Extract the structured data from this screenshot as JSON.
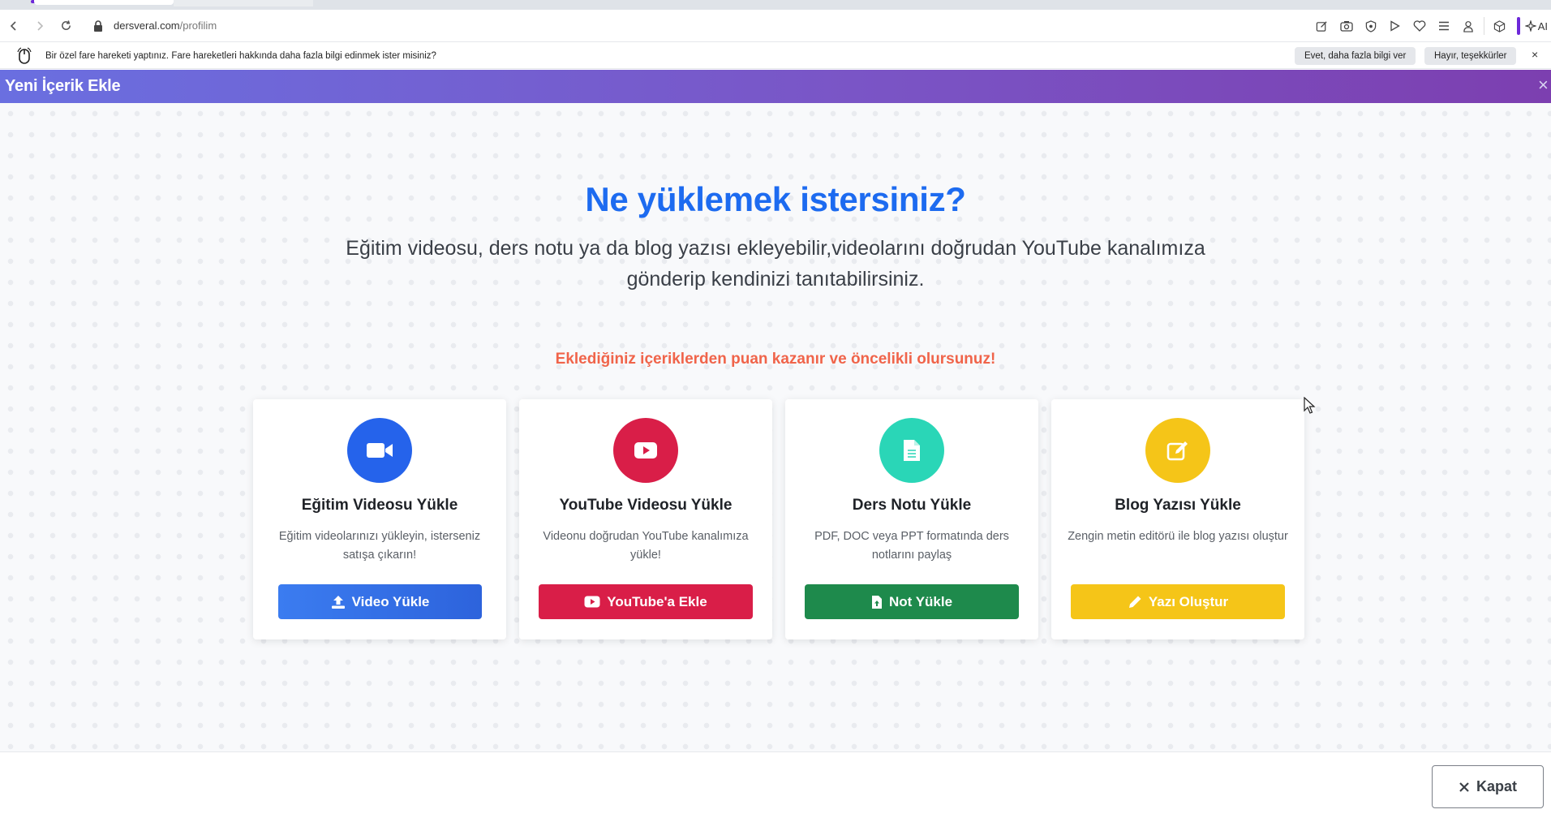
{
  "browser": {
    "url_host": "dersveral.com",
    "url_path": "/profilim",
    "ai_label": "AI",
    "infobar": {
      "message": "Bir özel fare hareketi yaptınız. Fare hareketleri hakkında daha fazla bilgi edinmek ister misiniz?",
      "yes_label": "Evet, daha fazla bilgi ver",
      "no_label": "Hayır, teşekkürler",
      "close_glyph": "×"
    }
  },
  "modal": {
    "title": "Yeni İçerik Ekle",
    "close_glyph": "×",
    "headline": "Ne yüklemek istersiniz?",
    "subtext": "Eğitim videosu, ders notu ya da blog yazısı ekleyebilir,videolarını doğrudan YouTube kanalımıza gönderip kendinizi tanıtabilirsiniz.",
    "promo": "Eklediğiniz içeriklerden puan kazanır ve öncelikli olursunuz!",
    "cards": [
      {
        "title": "Eğitim Videosu Yükle",
        "desc": "Eğitim videolarınızı yükleyin, isterseniz satışa çıkarın!",
        "button": "Video Yükle",
        "color": "#2563eb",
        "icon": "video-camera-icon"
      },
      {
        "title": "YouTube Videosu Yükle",
        "desc": "Videonu doğrudan YouTube kanalımıza yükle!",
        "button": "YouTube'a Ekle",
        "color": "#d91e48",
        "icon": "youtube-play-icon"
      },
      {
        "title": "Ders Notu Yükle",
        "desc": "PDF, DOC veya PPT formatında ders notlarını paylaş",
        "button": "Not Yükle",
        "color": "#2ad6b7",
        "icon": "document-icon"
      },
      {
        "title": "Blog Yazısı Yükle",
        "desc": "Zengin metin editörü ile blog yazısı oluştur",
        "button": "Yazı Oluştur",
        "color": "#f5c518",
        "icon": "edit-icon"
      }
    ],
    "close_button": "Kapat"
  }
}
